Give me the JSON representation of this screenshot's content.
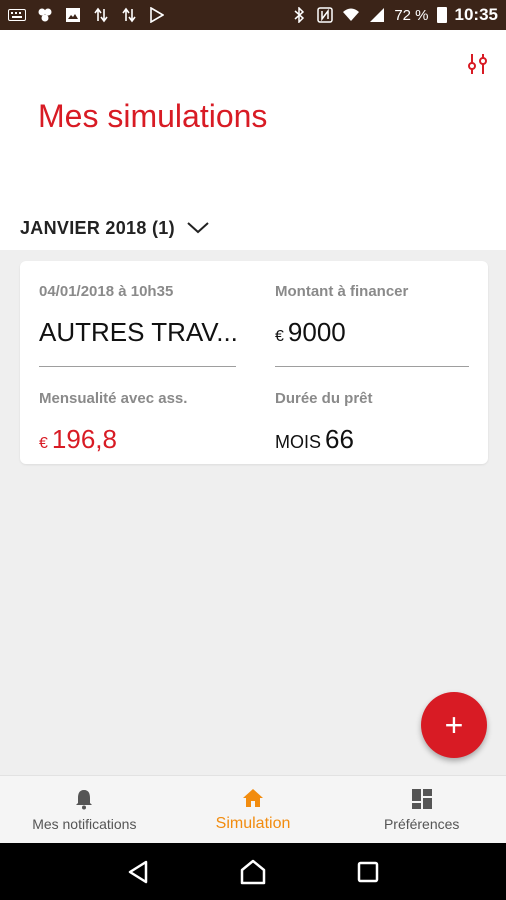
{
  "status_bar": {
    "battery": "72 %",
    "time": "10:35",
    "left_icons": [
      "keyboard-icon",
      "apps-icon",
      "image-icon",
      "sync-icon",
      "sync-icon",
      "play-store-icon"
    ],
    "right_icons": [
      "bluetooth-icon",
      "nfc-icon",
      "wifi-icon",
      "signal-icon",
      "battery-icon"
    ]
  },
  "header": {
    "title": "Mes simulations",
    "filter_icon": "filter-sliders-icon",
    "month_label": "JANVIER 2018 (1)"
  },
  "card": {
    "date": "04/01/2018 à 10h35",
    "name": "AUTRES TRAV...",
    "montant_label": "Montant à financer",
    "montant_currency": "€",
    "montant_value": "9000",
    "mensualite_label": "Mensualité avec ass.",
    "mensualite_currency": "€",
    "mensualite_value": "196,8",
    "duree_label": "Durée du prêt",
    "duree_unit": "MOIS",
    "duree_value": "66"
  },
  "fab": {
    "label": "+"
  },
  "bottom_nav": {
    "items": [
      {
        "label": "Mes notifications",
        "icon": "bell-icon",
        "active": false
      },
      {
        "label": "Simulation",
        "icon": "home-icon",
        "active": true
      },
      {
        "label": "Préférences",
        "icon": "dashboard-icon",
        "active": false
      }
    ]
  },
  "colors": {
    "accent": "#d81b24",
    "active_nav": "#f28c0f",
    "status_bar": "#3b2418"
  }
}
